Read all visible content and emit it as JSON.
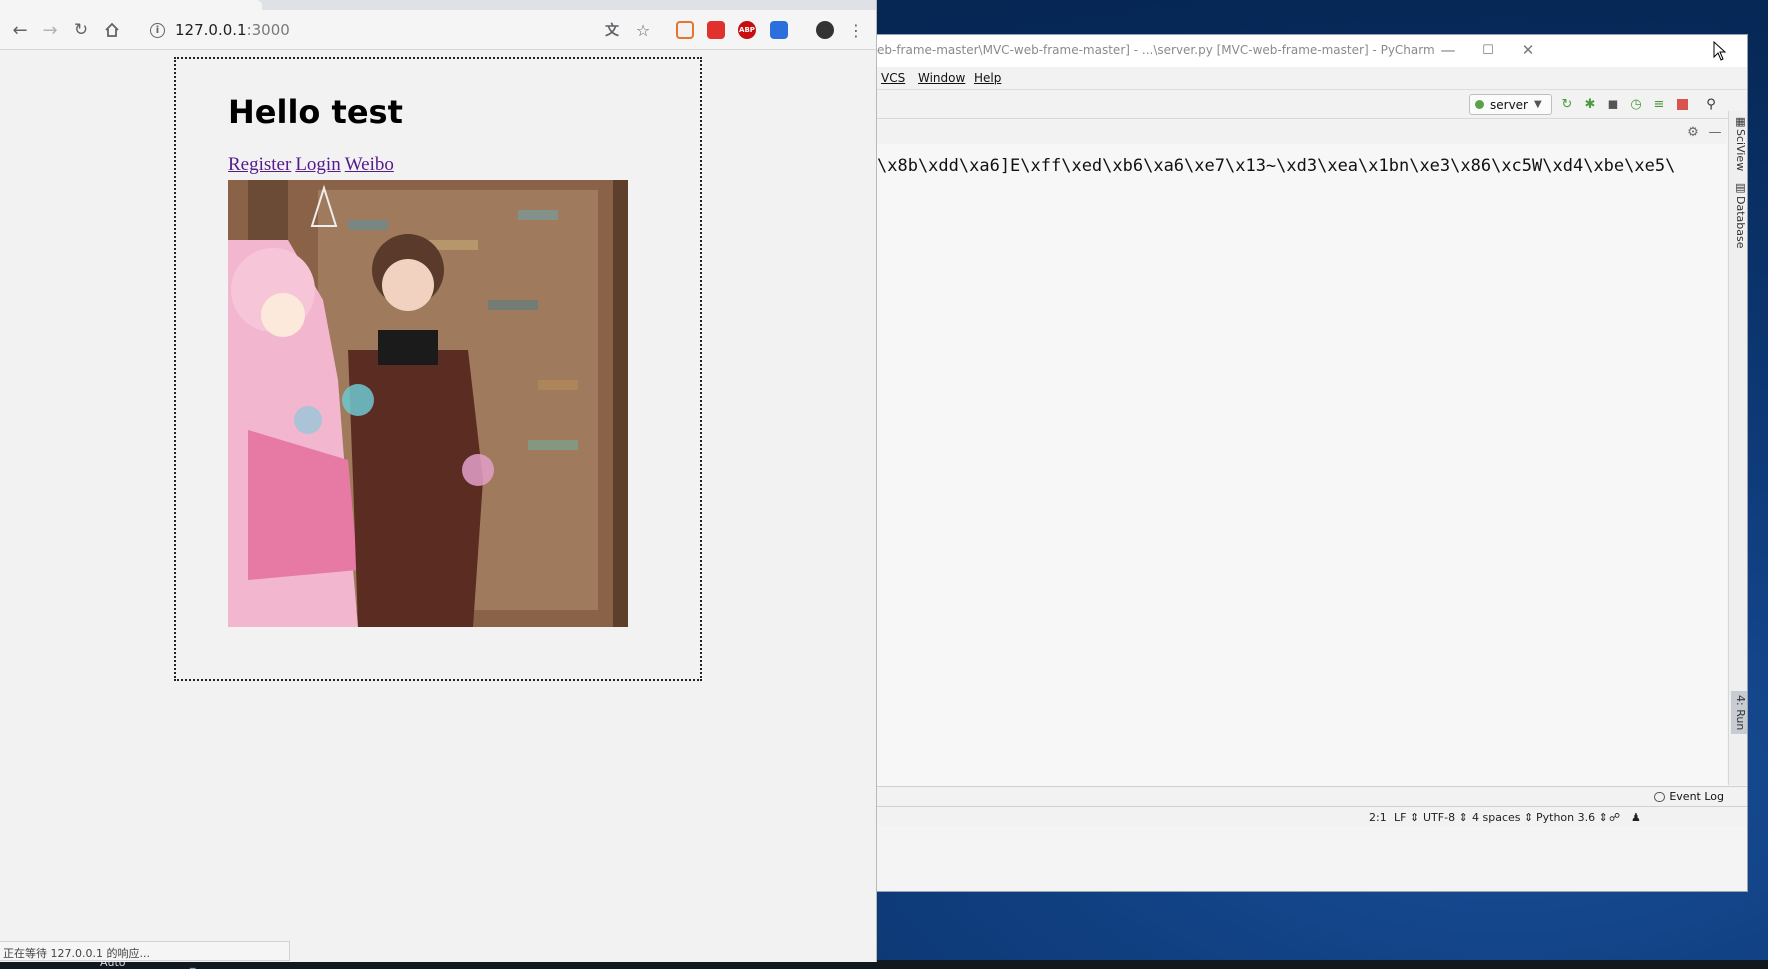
{
  "browser": {
    "url_host": "127.0.0.1",
    "url_port": ":3000",
    "status_text": "正在等待 127.0.0.1 的响应...",
    "extensions": [
      "translate-icon",
      "bookmark-star-icon",
      "extension-1-icon",
      "extension-2-icon",
      "adblock-plus-icon",
      "extension-3-icon",
      "profile-avatar"
    ],
    "adblock_label": "ABP"
  },
  "page": {
    "heading": "Hello test",
    "links": [
      "Register",
      "Login",
      "Weibo"
    ]
  },
  "ide": {
    "title": "eb-frame-master\\MVC-web-frame-master] - ...\\server.py [MVC-web-frame-master] - PyCharm",
    "menu": [
      "VCS",
      "Window",
      "Help"
    ],
    "run_config": "server",
    "console_output": "\\x8b\\xdd\\xa6]E\\xff\\xed\\xb6\\xa6\\xe7\\x13~\\xd3\\xea\\x1bn\\xe3\\x86\\xc5W\\xd4\\xbe\\xe5\\",
    "side_tabs": [
      "SciView",
      "Database",
      "4: Run"
    ],
    "event_log": "Event Log",
    "status": {
      "position": "2:1",
      "line_sep": "LF",
      "encoding": "UTF-8",
      "indent": "4 spaces",
      "interpreter": "Python 3.6"
    },
    "window_controls": [
      "minimize",
      "maximize",
      "close"
    ]
  },
  "taskbar": {
    "items": [
      "Auto",
      "_"
    ]
  },
  "colors": {
    "link_visited": "#551a8b",
    "desktop_blue": "#0e3b7a",
    "stop_red": "#d9534f",
    "run_green": "#4a9c3c"
  }
}
